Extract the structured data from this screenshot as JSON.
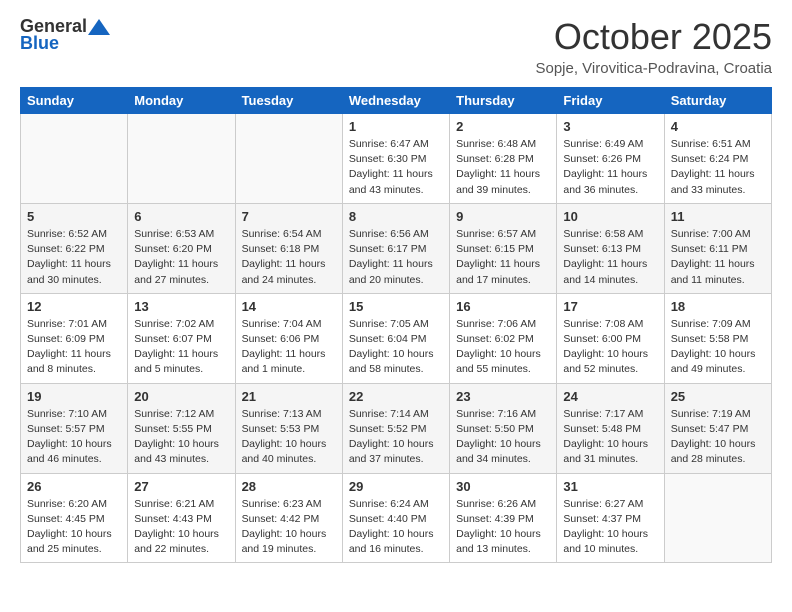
{
  "header": {
    "logo_general": "General",
    "logo_blue": "Blue",
    "month_title": "October 2025",
    "location": "Sopje, Virovitica-Podravina, Croatia"
  },
  "weekdays": [
    "Sunday",
    "Monday",
    "Tuesday",
    "Wednesday",
    "Thursday",
    "Friday",
    "Saturday"
  ],
  "weeks": [
    [
      {
        "day": "",
        "info": ""
      },
      {
        "day": "",
        "info": ""
      },
      {
        "day": "",
        "info": ""
      },
      {
        "day": "1",
        "info": "Sunrise: 6:47 AM\nSunset: 6:30 PM\nDaylight: 11 hours and 43 minutes."
      },
      {
        "day": "2",
        "info": "Sunrise: 6:48 AM\nSunset: 6:28 PM\nDaylight: 11 hours and 39 minutes."
      },
      {
        "day": "3",
        "info": "Sunrise: 6:49 AM\nSunset: 6:26 PM\nDaylight: 11 hours and 36 minutes."
      },
      {
        "day": "4",
        "info": "Sunrise: 6:51 AM\nSunset: 6:24 PM\nDaylight: 11 hours and 33 minutes."
      }
    ],
    [
      {
        "day": "5",
        "info": "Sunrise: 6:52 AM\nSunset: 6:22 PM\nDaylight: 11 hours and 30 minutes."
      },
      {
        "day": "6",
        "info": "Sunrise: 6:53 AM\nSunset: 6:20 PM\nDaylight: 11 hours and 27 minutes."
      },
      {
        "day": "7",
        "info": "Sunrise: 6:54 AM\nSunset: 6:18 PM\nDaylight: 11 hours and 24 minutes."
      },
      {
        "day": "8",
        "info": "Sunrise: 6:56 AM\nSunset: 6:17 PM\nDaylight: 11 hours and 20 minutes."
      },
      {
        "day": "9",
        "info": "Sunrise: 6:57 AM\nSunset: 6:15 PM\nDaylight: 11 hours and 17 minutes."
      },
      {
        "day": "10",
        "info": "Sunrise: 6:58 AM\nSunset: 6:13 PM\nDaylight: 11 hours and 14 minutes."
      },
      {
        "day": "11",
        "info": "Sunrise: 7:00 AM\nSunset: 6:11 PM\nDaylight: 11 hours and 11 minutes."
      }
    ],
    [
      {
        "day": "12",
        "info": "Sunrise: 7:01 AM\nSunset: 6:09 PM\nDaylight: 11 hours and 8 minutes."
      },
      {
        "day": "13",
        "info": "Sunrise: 7:02 AM\nSunset: 6:07 PM\nDaylight: 11 hours and 5 minutes."
      },
      {
        "day": "14",
        "info": "Sunrise: 7:04 AM\nSunset: 6:06 PM\nDaylight: 11 hours and 1 minute."
      },
      {
        "day": "15",
        "info": "Sunrise: 7:05 AM\nSunset: 6:04 PM\nDaylight: 10 hours and 58 minutes."
      },
      {
        "day": "16",
        "info": "Sunrise: 7:06 AM\nSunset: 6:02 PM\nDaylight: 10 hours and 55 minutes."
      },
      {
        "day": "17",
        "info": "Sunrise: 7:08 AM\nSunset: 6:00 PM\nDaylight: 10 hours and 52 minutes."
      },
      {
        "day": "18",
        "info": "Sunrise: 7:09 AM\nSunset: 5:58 PM\nDaylight: 10 hours and 49 minutes."
      }
    ],
    [
      {
        "day": "19",
        "info": "Sunrise: 7:10 AM\nSunset: 5:57 PM\nDaylight: 10 hours and 46 minutes."
      },
      {
        "day": "20",
        "info": "Sunrise: 7:12 AM\nSunset: 5:55 PM\nDaylight: 10 hours and 43 minutes."
      },
      {
        "day": "21",
        "info": "Sunrise: 7:13 AM\nSunset: 5:53 PM\nDaylight: 10 hours and 40 minutes."
      },
      {
        "day": "22",
        "info": "Sunrise: 7:14 AM\nSunset: 5:52 PM\nDaylight: 10 hours and 37 minutes."
      },
      {
        "day": "23",
        "info": "Sunrise: 7:16 AM\nSunset: 5:50 PM\nDaylight: 10 hours and 34 minutes."
      },
      {
        "day": "24",
        "info": "Sunrise: 7:17 AM\nSunset: 5:48 PM\nDaylight: 10 hours and 31 minutes."
      },
      {
        "day": "25",
        "info": "Sunrise: 7:19 AM\nSunset: 5:47 PM\nDaylight: 10 hours and 28 minutes."
      }
    ],
    [
      {
        "day": "26",
        "info": "Sunrise: 6:20 AM\nSunset: 4:45 PM\nDaylight: 10 hours and 25 minutes."
      },
      {
        "day": "27",
        "info": "Sunrise: 6:21 AM\nSunset: 4:43 PM\nDaylight: 10 hours and 22 minutes."
      },
      {
        "day": "28",
        "info": "Sunrise: 6:23 AM\nSunset: 4:42 PM\nDaylight: 10 hours and 19 minutes."
      },
      {
        "day": "29",
        "info": "Sunrise: 6:24 AM\nSunset: 4:40 PM\nDaylight: 10 hours and 16 minutes."
      },
      {
        "day": "30",
        "info": "Sunrise: 6:26 AM\nSunset: 4:39 PM\nDaylight: 10 hours and 13 minutes."
      },
      {
        "day": "31",
        "info": "Sunrise: 6:27 AM\nSunset: 4:37 PM\nDaylight: 10 hours and 10 minutes."
      },
      {
        "day": "",
        "info": ""
      }
    ]
  ]
}
